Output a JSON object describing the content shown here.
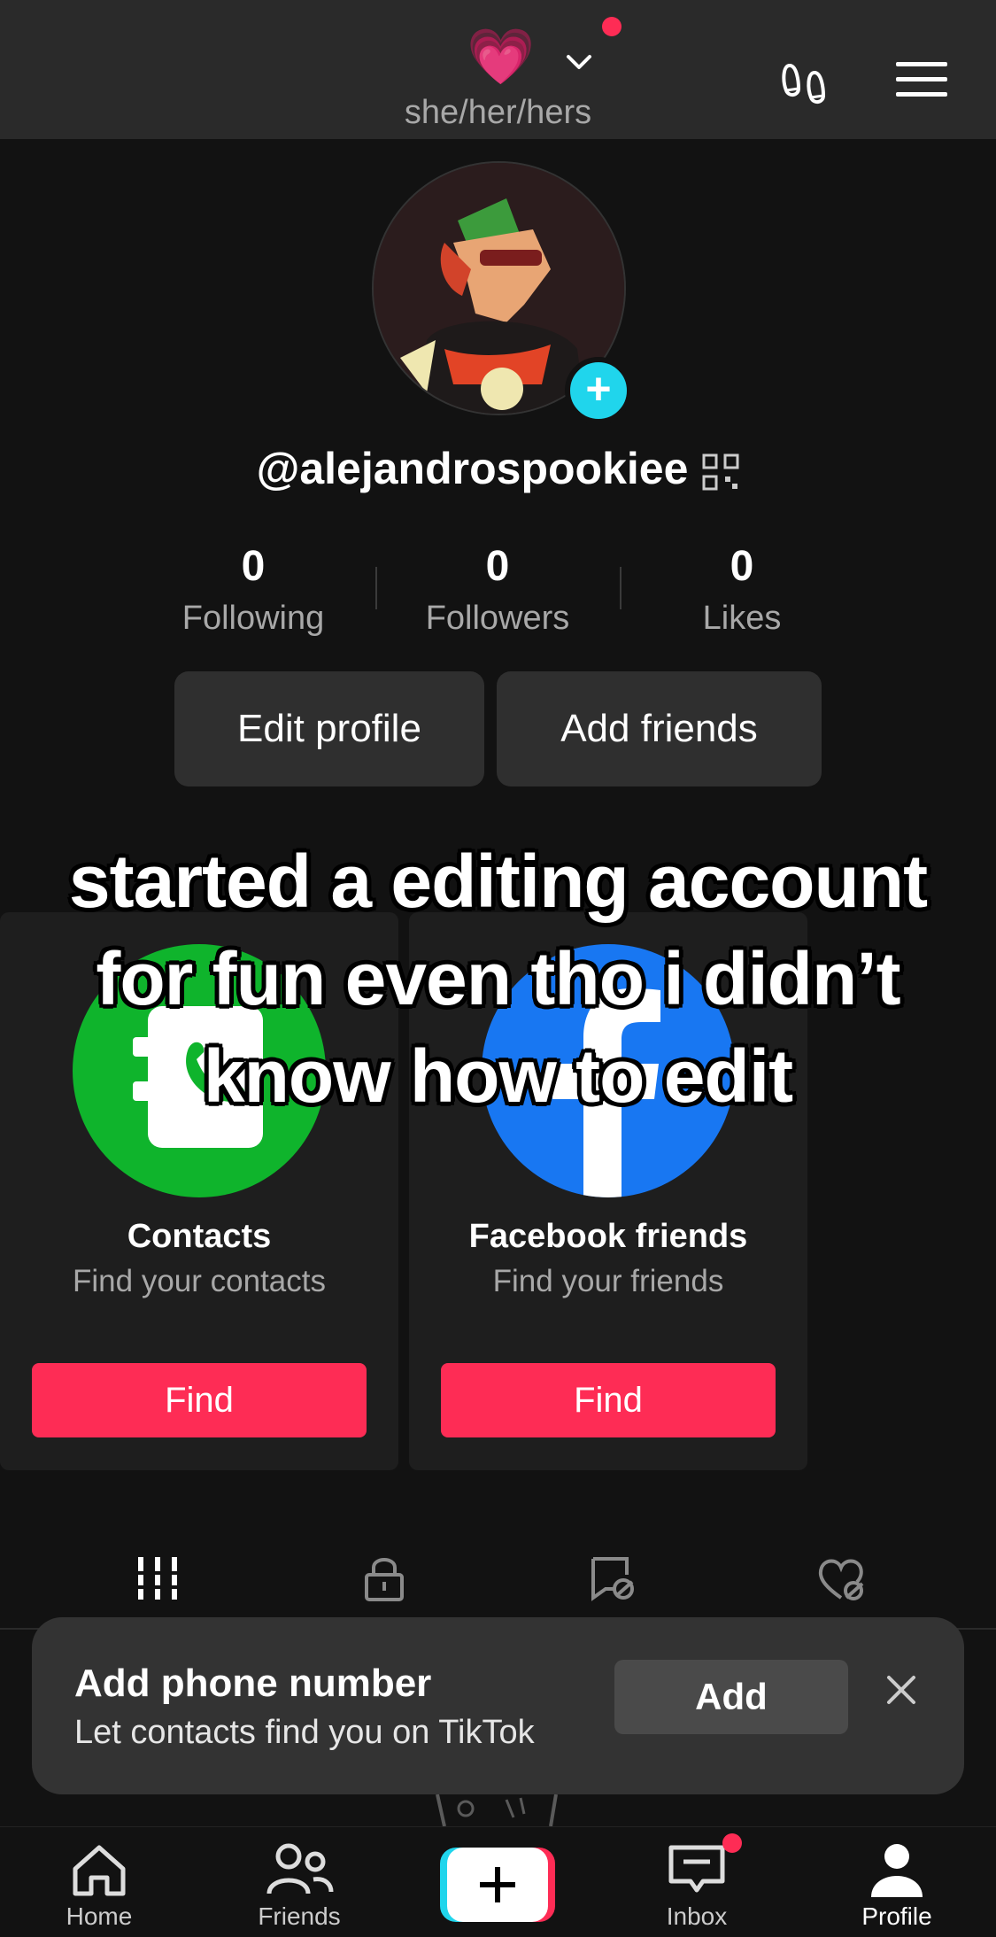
{
  "header": {
    "pronouns": "she/her/hers",
    "emoji": "💗",
    "icons": [
      "pink-heart-icon",
      "chevron-down-icon",
      "footprint-icon",
      "hamburger-menu-icon"
    ]
  },
  "profile": {
    "username": "@alejandrospookiee",
    "stats": [
      {
        "value": "0",
        "label": "Following"
      },
      {
        "value": "0",
        "label": "Followers"
      },
      {
        "value": "0",
        "label": "Likes"
      }
    ],
    "edit_label": "Edit profile",
    "add_friends_label": "Add friends"
  },
  "suggestions": [
    {
      "title": "Contacts",
      "subtitle": "Find your contacts",
      "button": "Find",
      "color": "#0fb42c"
    },
    {
      "title": "Facebook friends",
      "subtitle": "Find your friends",
      "button": "Find",
      "color": "#1877f2"
    }
  ],
  "overlay_caption": "started a editing account for fun even tho i didn’t know how to edit",
  "tabs": [
    "videos-grid-icon",
    "private-lock-icon",
    "reposts-icon",
    "liked-hidden-icon"
  ],
  "toast": {
    "title": "Add phone number",
    "subtitle": "Let contacts find you on TikTok",
    "button": "Add"
  },
  "bottom_nav": [
    {
      "label": "Home"
    },
    {
      "label": "Friends"
    },
    {
      "label": ""
    },
    {
      "label": "Inbox"
    },
    {
      "label": "Profile"
    }
  ],
  "colors": {
    "accent": "#fe2c55",
    "cyan": "#20d5ec",
    "background": "#121212"
  }
}
